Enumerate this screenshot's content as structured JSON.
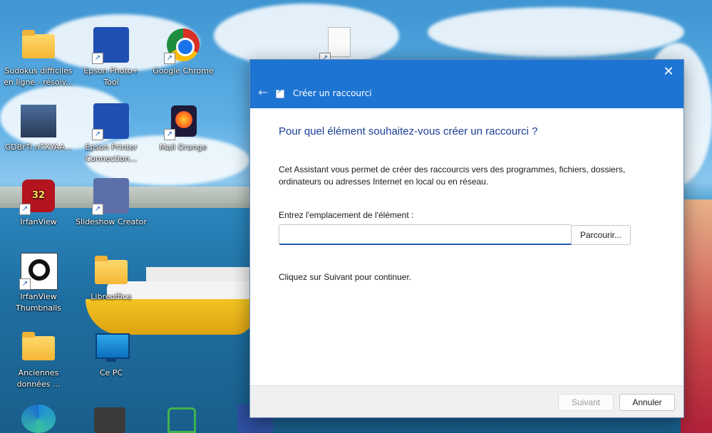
{
  "desktop": {
    "icons": [
      {
        "label": "Sudokus difficiles en ligne - résolv...",
        "icon": "folder-icon"
      },
      {
        "label": "Epson Photo+ Tool",
        "icon": "epson-photo-icon"
      },
      {
        "label": "Google Chrome",
        "icon": "chrome-icon"
      },
      {
        "label": "GDBrTi nTXYAA...",
        "icon": "photo-thumbnail-icon"
      },
      {
        "label": "Epson Printer Connection...",
        "icon": "epson-printer-icon"
      },
      {
        "label": "Mail Orange",
        "icon": "firefox-icon"
      },
      {
        "label": "IrfanView",
        "icon": "irfanview-icon"
      },
      {
        "label": "Slideshow Creator",
        "icon": "slideshow-icon"
      },
      {
        "label": "IrfanView Thumbnails",
        "icon": "panda-icon"
      },
      {
        "label": "Libreoffice",
        "icon": "folder-icon"
      },
      {
        "label": "Anciennes données ...",
        "icon": "folder-icon"
      },
      {
        "label": "Ce PC",
        "icon": "monitor-icon"
      }
    ],
    "irfanview_badge": "32"
  },
  "dialog": {
    "title": "Créer un raccourci",
    "heading": "Pour quel élément souhaitez-vous créer un raccourci ?",
    "description": "Cet Assistant vous permet de créer des raccourcis vers des programmes, fichiers, dossiers, ordinateurs ou adresses Internet en local ou en réseau.",
    "location_label": "Entrez l'emplacement de l'élément :",
    "location_value": "",
    "browse_label": "Parcourir...",
    "continue_text": "Cliquez sur Suivant pour continuer.",
    "next_label": "Suivant",
    "cancel_label": "Annuler",
    "close_glyph": "✕",
    "back_glyph": "←",
    "accent_color": "#1e74d3",
    "heading_color": "#1a3d97"
  }
}
